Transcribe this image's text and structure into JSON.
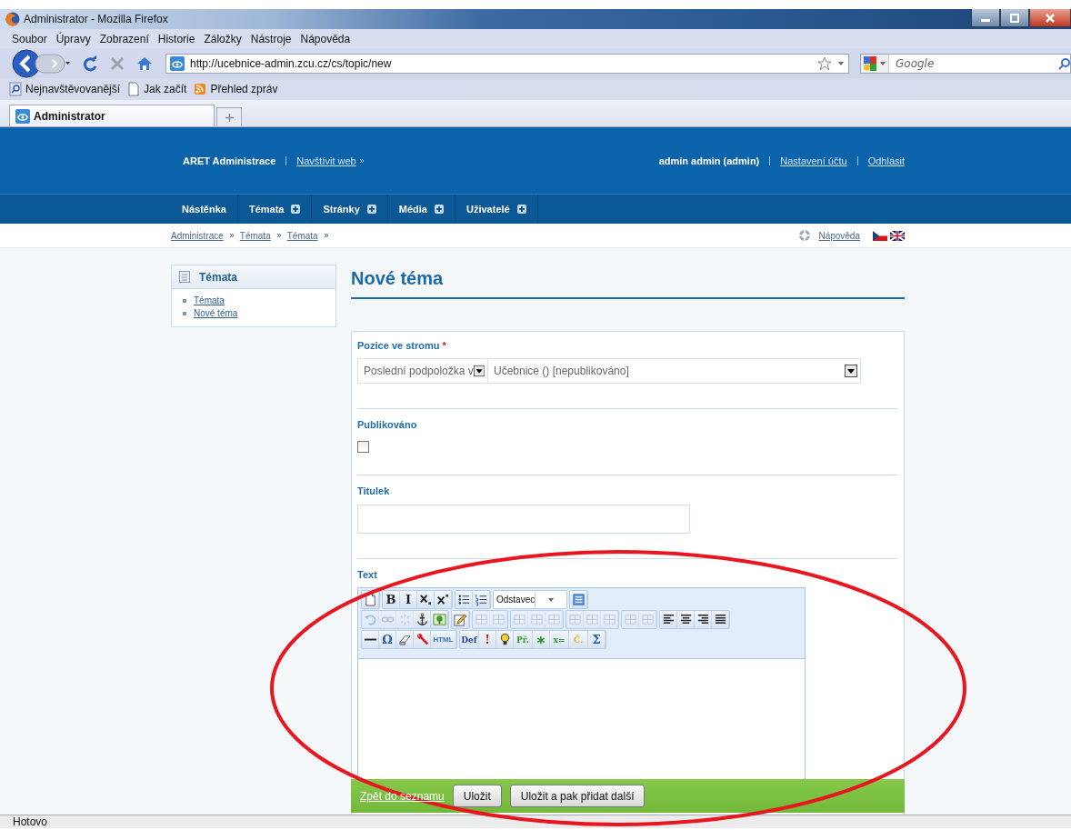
{
  "window": {
    "title": "Administrator - Mozilla Firefox"
  },
  "menu_bar": [
    "Soubor",
    "Úpravy",
    "Zobrazení",
    "Historie",
    "Záložky",
    "Nástroje",
    "Nápověda"
  ],
  "address_bar": {
    "url": "http://ucebnice-admin.zcu.cz/cs/topic/new"
  },
  "search_field": {
    "placeholder": "Google"
  },
  "bookmarks": [
    "Nejnavštěvovanější",
    "Jak začít",
    "Přehled zpráv"
  ],
  "tabs": [
    {
      "label": "Administrator",
      "selected": true
    }
  ],
  "header": {
    "site_title": "ARET Administrace",
    "visit_link": "Navštívit web",
    "user": "admin admin (admin)",
    "links": [
      "Nastavení účtu",
      "Odhlásit"
    ]
  },
  "nav": [
    {
      "label": "Nástěnka",
      "expandable": false
    },
    {
      "label": "Témata",
      "expandable": true
    },
    {
      "label": "Stránky",
      "expandable": true
    },
    {
      "label": "Média",
      "expandable": true
    },
    {
      "label": "Uživatelé",
      "expandable": true
    }
  ],
  "breadcrumb": [
    "Administrace",
    "Témata",
    "Témata"
  ],
  "help_link": "Nápověda",
  "sidebar": {
    "title": "Témata",
    "items": [
      "Témata",
      "Nové téma"
    ]
  },
  "page_title": "Nové téma",
  "form": {
    "position": {
      "label": "Pozice ve stromu",
      "required_mark": "*",
      "mode": "Poslední podpoložka v",
      "parent": "Učebnice () [nepublikováno]"
    },
    "published": {
      "label": "Publikováno",
      "checked": false
    },
    "caption": {
      "label": "Titulek"
    },
    "text": {
      "label": "Text",
      "toolbar": [
        [
          [
            {
              "kind": "icon",
              "disabled": false
            }
          ],
          [
            {
              "kind": "glyph",
              "label": "B",
              "color": "#1a1a1a",
              "disabled": false
            },
            {
              "kind": "glyph",
              "label": "I",
              "color": "#1a1a1a",
              "disabled": false
            },
            {
              "kind": "icon",
              "disabled": false
            },
            {
              "kind": "icon",
              "disabled": false
            }
          ],
          [
            {
              "kind": "icon",
              "disabled": false
            },
            {
              "kind": "icon",
              "disabled": false
            }
          ],
          [
            {
              "kind": "select",
              "value": "Odstavec"
            }
          ],
          [
            {
              "kind": "icon",
              "disabled": false
            }
          ]
        ],
        [
          [
            {
              "kind": "icon",
              "disabled": true
            },
            {
              "kind": "icon",
              "disabled": true
            },
            {
              "kind": "icon",
              "disabled": true
            },
            {
              "kind": "icon",
              "disabled": false
            },
            {
              "kind": "icon",
              "disabled": false
            }
          ],
          [
            {
              "kind": "icon",
              "disabled": false
            }
          ],
          [
            {
              "kind": "icon",
              "disabled": true
            },
            {
              "kind": "icon",
              "disabled": true
            }
          ],
          [
            {
              "kind": "icon",
              "disabled": true
            },
            {
              "kind": "icon",
              "disabled": true
            },
            {
              "kind": "icon",
              "disabled": true
            }
          ],
          [
            {
              "kind": "icon",
              "disabled": true
            },
            {
              "kind": "icon",
              "disabled": true
            },
            {
              "kind": "icon",
              "disabled": true
            }
          ],
          [
            {
              "kind": "icon",
              "disabled": true
            },
            {
              "kind": "icon",
              "disabled": true
            }
          ],
          [
            {
              "kind": "icon",
              "disabled": false
            },
            {
              "kind": "icon",
              "disabled": false
            },
            {
              "kind": "icon",
              "disabled": false
            },
            {
              "kind": "icon",
              "disabled": false
            }
          ]
        ],
        [
          [
            {
              "kind": "icon",
              "disabled": false
            },
            {
              "kind": "glyph",
              "label": "Ω",
              "color": "#2a5db0",
              "disabled": false
            },
            {
              "kind": "icon",
              "disabled": false
            },
            {
              "kind": "icon",
              "disabled": false
            },
            {
              "kind": "glyph",
              "label": "HTML",
              "color": "#3b6fc0",
              "disabled": false
            }
          ],
          [
            {
              "kind": "glyph",
              "label": "Def",
              "color": "#1b3f8f",
              "disabled": false
            },
            {
              "kind": "glyph",
              "label": "!",
              "color": "#e01010",
              "disabled": false
            },
            {
              "kind": "icon",
              "disabled": false
            },
            {
              "kind": "glyph",
              "label": "Př.",
              "color": "#2e9a2e",
              "disabled": false
            },
            {
              "kind": "glyph",
              "label": "*",
              "color": "#1e8a1e",
              "disabled": false
            },
            {
              "kind": "glyph",
              "label": "x=",
              "color": "#2e9a2e",
              "disabled": false
            },
            {
              "kind": "glyph",
              "label": "Č.",
              "color": "#f0b020",
              "disabled": false
            },
            {
              "kind": "glyph",
              "label": "Σ",
              "color": "#1560c0",
              "disabled": false
            }
          ]
        ]
      ]
    }
  },
  "footer": {
    "back_link": "Zpět do seznamu",
    "buttons": [
      "Uložit",
      "Uložit a pak přidat další"
    ]
  },
  "status_bar": {
    "text": "Hotovo"
  }
}
